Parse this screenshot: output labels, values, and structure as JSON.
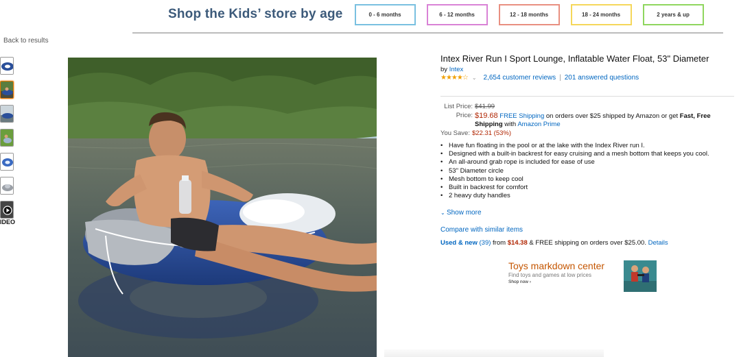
{
  "kids_banner": {
    "title": "Shop the Kids’ store by age",
    "age_buttons": [
      {
        "label": "0 - 6 months",
        "color": "#79c0e0"
      },
      {
        "label": "6 - 12 months",
        "color": "#d982d6"
      },
      {
        "label": "12 - 18 months",
        "color": "#e88f80"
      },
      {
        "label": "18 - 24 months",
        "color": "#f5d75a"
      },
      {
        "label": "2 years & up",
        "color": "#8fd65e"
      }
    ]
  },
  "nav": {
    "back_label": "Back to results"
  },
  "gallery": {
    "thumbnails": [
      "thumb-1",
      "thumb-2",
      "thumb-3",
      "thumb-4",
      "thumb-5",
      "thumb-6",
      "video-thumb"
    ],
    "video_label": "IDEO"
  },
  "product": {
    "title": "Intex River Run I Sport Lounge, Inflatable Water Float, 53\" Diameter",
    "by_label": "by",
    "brand": "Intex",
    "stars": "★★★★☆",
    "reviews_label": "2,654 customer reviews",
    "questions_label": "201 answered questions"
  },
  "pricing": {
    "list_price_label": "List Price:",
    "list_price": "$41.99",
    "price_label": "Price:",
    "price": "$19.68",
    "free_shipping_link": "FREE Shipping",
    "shipping_text": "on orders over $25 shipped by Amazon or get",
    "fast_text": "Fast, Free Shipping",
    "with_text": "with",
    "prime_link": "Amazon Prime",
    "save_label": "You Save:",
    "save_value": "$22.31 (53%)"
  },
  "features": [
    "Have fun floating in the pool or at the lake with the Index River run I.",
    "Designed with a built-in backrest for easy cruising and a mesh bottom that keeps you cool.",
    "An all-around grab rope is included for ease of use",
    "53\" Diameter circle",
    "Mesh bottom to keep cool",
    "Built in backrest for comfort",
    "2 heavy duty handles"
  ],
  "show_more_label": "Show more",
  "compare_label": "Compare with similar items",
  "offers": {
    "used_new_link": "Used & new",
    "count": "(39)",
    "from_text": "from",
    "from_price": "$14.38",
    "shipping_text": "& FREE shipping on orders over $25.00.",
    "details_link": "Details"
  },
  "ad": {
    "title": "Toys markdown center",
    "subtitle": "Find toys and games at low prices",
    "cta": "Shop now ›"
  }
}
